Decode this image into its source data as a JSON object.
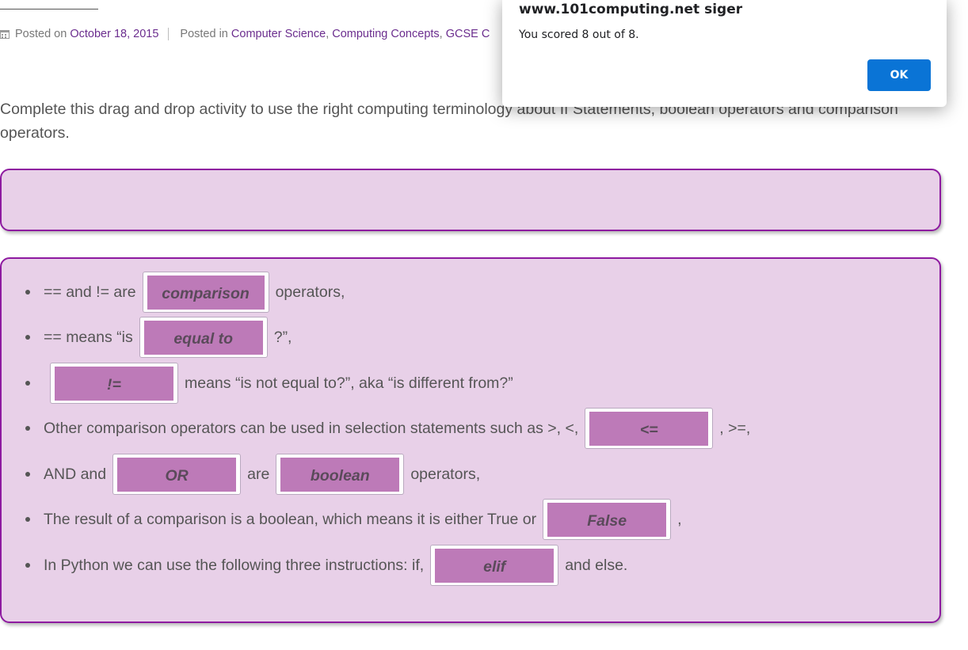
{
  "post_meta": {
    "posted_on_label": "Posted on",
    "date": "October 18, 2015",
    "posted_in_label": "Posted in",
    "category_1": "Computer Science",
    "comma_1": ",",
    "category_2": "Computing Concepts",
    "comma_2": ",",
    "category_3": "GCSE C"
  },
  "intro": {
    "text": "Complete this drag and drop activity to use the right computing terminology about If Statements, boolean operators and comparison operators."
  },
  "sentences": [
    {
      "before": "== and != are",
      "answer": "comparison",
      "after": "operators,"
    },
    {
      "before": "== means “is",
      "answer": "equal to",
      "after": "?”,"
    },
    {
      "answer": "!=",
      "after": "means “is not equal to?”, aka “is different from?”"
    },
    {
      "before": "Other comparison operators can be used in selection statements such as >, <,",
      "answer": "<=",
      "after": ", >=,"
    },
    {
      "before": "AND and",
      "answer": "OR",
      "middle": "are",
      "answer_2": "boolean",
      "after": "operators,"
    },
    {
      "before": "The result of a comparison is a boolean, which means it is either True or",
      "answer": "False",
      "after": ","
    },
    {
      "before": "In Python we can use the following three instructions: if,",
      "answer": "elif",
      "after": "and else."
    }
  ],
  "dialog": {
    "origin": "www.101computing.net siger",
    "message": "You scored 8 out of 8.",
    "ok_label": "OK",
    "accent": "#0a74d6"
  },
  "colors": {
    "box_background": "#e8d0e8",
    "box_border": "#8e1aa0",
    "tile_background": "#bd7ab8",
    "link": "#6b2d8e"
  }
}
